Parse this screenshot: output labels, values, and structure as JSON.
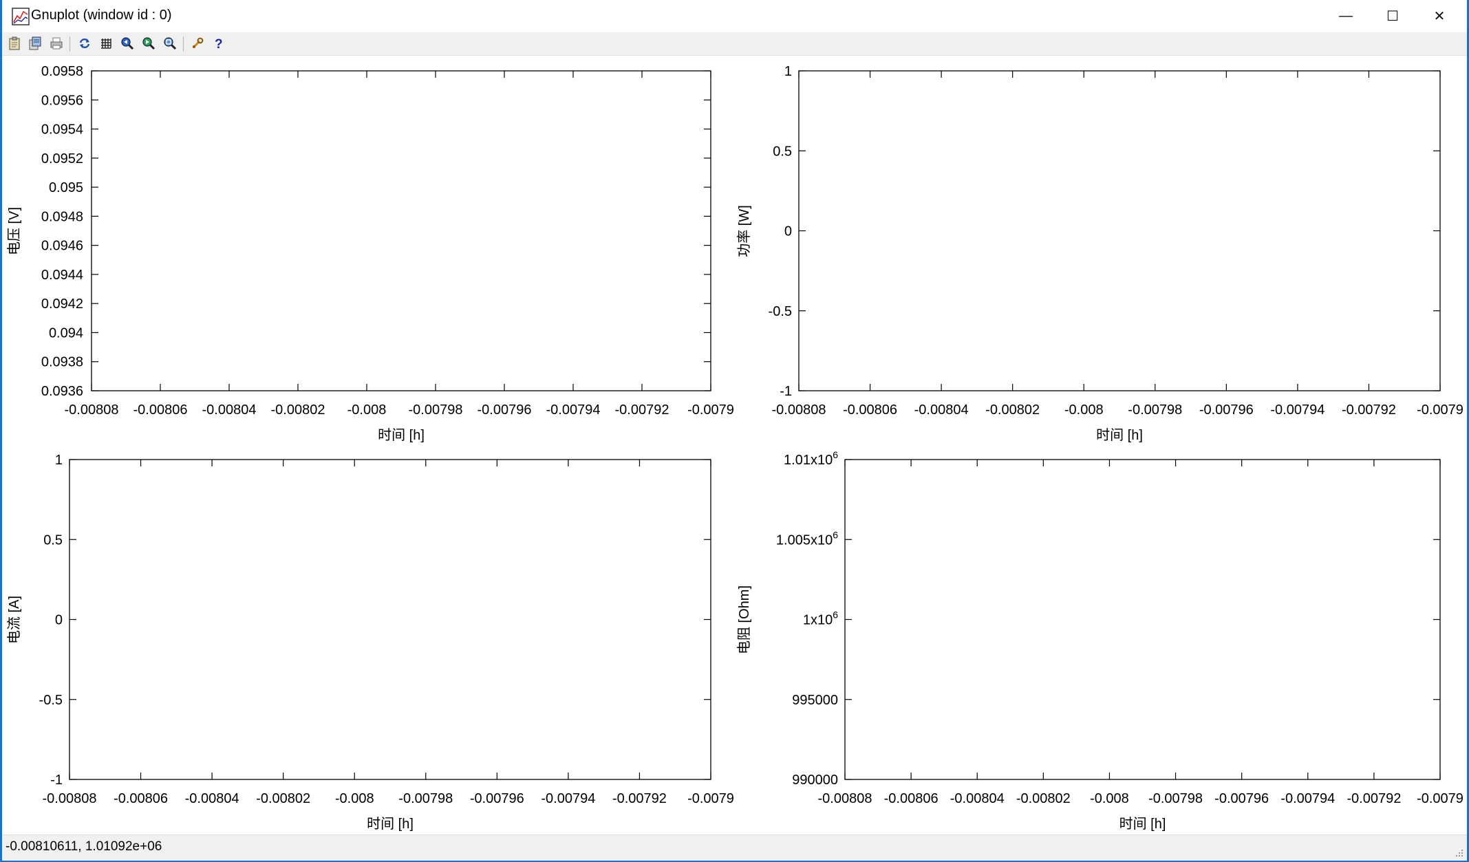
{
  "window": {
    "title": "Gnuplot (window id : 0)",
    "controls": {
      "minimize": "—",
      "maximize": "☐",
      "close": "✕"
    }
  },
  "toolbar": {
    "buttons": [
      {
        "name": "copy-clipboard-button",
        "icon": "clipboard-icon"
      },
      {
        "name": "save-button",
        "icon": "save-icon"
      },
      {
        "name": "print-button",
        "icon": "printer-icon"
      },
      {
        "name": "replot-button",
        "icon": "refresh-icon"
      },
      {
        "name": "grid-button",
        "icon": "grid-icon"
      },
      {
        "name": "zoom-previous-button",
        "icon": "zoom-prev-icon"
      },
      {
        "name": "zoom-next-button",
        "icon": "zoom-next-icon"
      },
      {
        "name": "zoom-reset-button",
        "icon": "zoom-reset-icon"
      },
      {
        "name": "options-button",
        "icon": "wrench-icon"
      },
      {
        "name": "help-button",
        "icon": "help-icon"
      }
    ]
  },
  "status": {
    "text": "-0.00810611,  1.01092e+06"
  },
  "chart_data": [
    {
      "type": "line",
      "xlabel": "时间 [h]",
      "ylabel": "电压 [V]",
      "xlim": [
        -0.00808,
        -0.0079
      ],
      "ylim": [
        0.0936,
        0.0958
      ],
      "xticks": [
        "-0.00808",
        "-0.00806",
        "-0.00804",
        "-0.00802",
        "-0.008",
        "-0.00798",
        "-0.00796",
        "-0.00794",
        "-0.00792",
        "-0.0079"
      ],
      "yticks": [
        "0.0936",
        "0.0938",
        "0.094",
        "0.0942",
        "0.0944",
        "0.0946",
        "0.0948",
        "0.095",
        "0.0952",
        "0.0954",
        "0.0956",
        "0.0958"
      ],
      "series": [],
      "grid": false
    },
    {
      "type": "line",
      "xlabel": "时间 [h]",
      "ylabel": "功率 [W]",
      "xlim": [
        -0.00808,
        -0.0079
      ],
      "ylim": [
        -1,
        1
      ],
      "xticks": [
        "-0.00808",
        "-0.00806",
        "-0.00804",
        "-0.00802",
        "-0.008",
        "-0.00798",
        "-0.00796",
        "-0.00794",
        "-0.00792",
        "-0.0079"
      ],
      "yticks": [
        "-1",
        "-0.5",
        "0",
        "0.5",
        "1"
      ],
      "series": [],
      "grid": false
    },
    {
      "type": "line",
      "xlabel": "时间 [h]",
      "ylabel": "电流 [A]",
      "xlim": [
        -0.00808,
        -0.0079
      ],
      "ylim": [
        -1,
        1
      ],
      "xticks": [
        "-0.00808",
        "-0.00806",
        "-0.00804",
        "-0.00802",
        "-0.008",
        "-0.00798",
        "-0.00796",
        "-0.00794",
        "-0.00792",
        "-0.0079"
      ],
      "yticks": [
        "-1",
        "-0.5",
        "0",
        "0.5",
        "1"
      ],
      "series": [],
      "grid": false
    },
    {
      "type": "line",
      "xlabel": "时间 [h]",
      "ylabel": "电阻 [Ohm]",
      "xlim": [
        -0.00808,
        -0.0079
      ],
      "ylim": [
        990000,
        1010000
      ],
      "xticks": [
        "-0.00808",
        "-0.00806",
        "-0.00804",
        "-0.00802",
        "-0.008",
        "-0.00798",
        "-0.00796",
        "-0.00794",
        "-0.00792",
        "-0.0079"
      ],
      "yticks": [
        "990000",
        "995000",
        "1x10^6",
        "1.005x10^6",
        "1.01x10^6"
      ],
      "series": [],
      "grid": false
    }
  ]
}
